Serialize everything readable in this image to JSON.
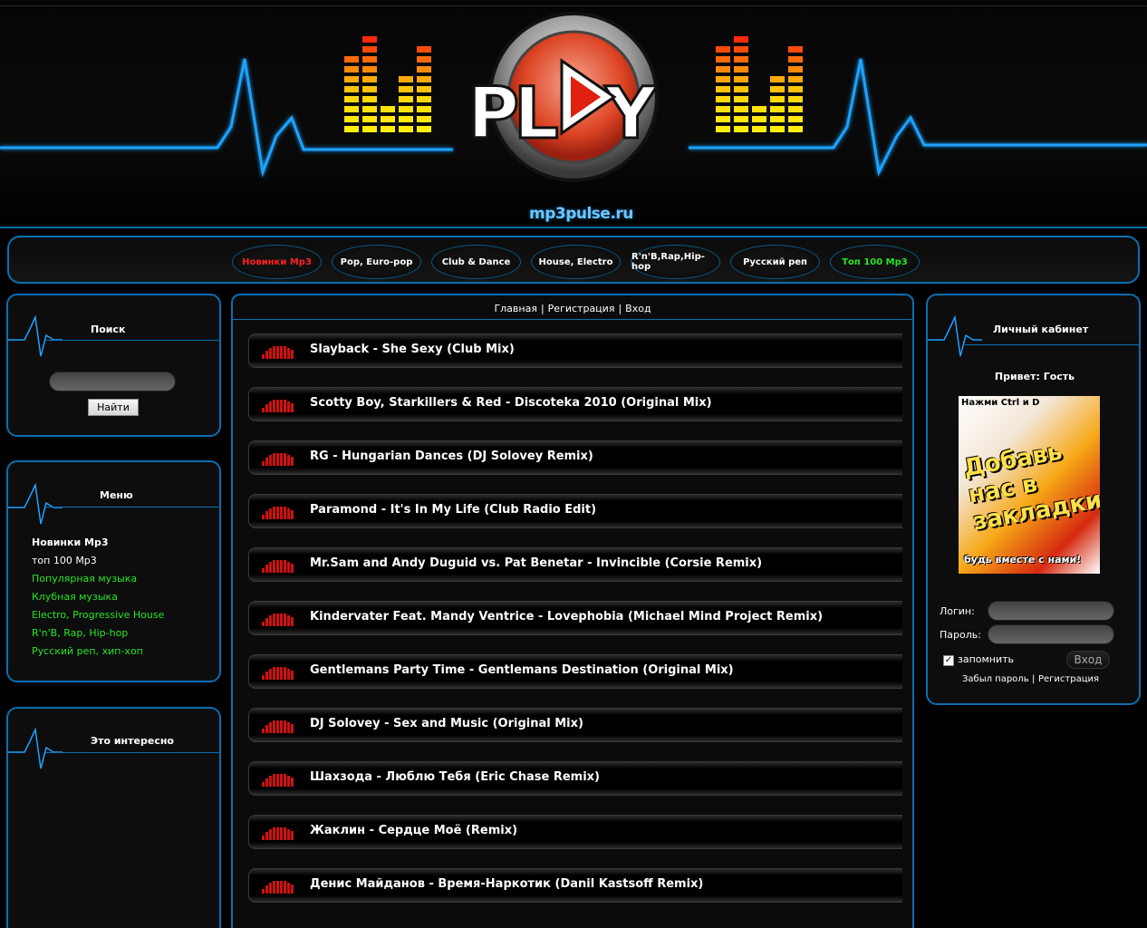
{
  "header": {
    "logo_text": "PLAY",
    "site_url": "mp3pulse.ru"
  },
  "nav": {
    "items": [
      {
        "label": "Новинки Mp3",
        "color": "#ff2020"
      },
      {
        "label": "Pop, Euro-pop"
      },
      {
        "label": "Club & Dance"
      },
      {
        "label": "House, Electro"
      },
      {
        "label": "R'n'B,Rap,Hip-hop"
      },
      {
        "label": "Русский реп"
      },
      {
        "label": "Топ 100 Mp3",
        "color": "#25e525"
      }
    ]
  },
  "search": {
    "title": "Поиск",
    "button_label": "Найти"
  },
  "menu": {
    "title": "Меню",
    "items": [
      {
        "label": "Новинки Mp3"
      },
      {
        "label": "топ 100 Mp3"
      },
      {
        "label": "Популярная музыка"
      },
      {
        "label": "Клубная музыка"
      },
      {
        "label": "Electro, Progressive House"
      },
      {
        "label": "R'n'B, Rap, Hip-hop"
      },
      {
        "label": "Русский реп, хип-хоп"
      }
    ]
  },
  "interesting": {
    "title": "Это интересно"
  },
  "breadcrumb": {
    "home": "Главная",
    "register": "Регистрация",
    "login": "Вход"
  },
  "tracks": [
    "Slayback - She Sexy (Club Mix)",
    "Scotty Boy, Starkillers & Red - Discoteka 2010 (Original Mix)",
    "RG - Hungarian Dances (DJ Solovey Remix)",
    "Paramond - It's In My Life (Club Radio Edit)",
    "Mr.Sam and Andy Duguid vs. Pat Benetar - Invincible (Corsie Remix)",
    "Kindervater Feat. Mandy Ventrice - Lovephobia (Michael Mind Project Remix)",
    "Gentlemans Party Time - Gentlemans Destination (Original Mix)",
    "DJ Solovey - Sex and Music (Original Mix)",
    "Шахзода - Люблю Тебя (Eric Chase Remix)",
    "Жаклин - Сердце Моё (Remix)",
    "Денис Майданов - Время-Наркотик (Danil Kastsoff Remix)"
  ],
  "account": {
    "title": "Личный кабинет",
    "greeting": "Привет: Гость",
    "banner_top": "Нажми Ctrl и D",
    "banner_main": "Добавь нас в закладки!",
    "banner_bottom": "будь вместе с нами!",
    "login_label": "Логин:",
    "password_label": "Пароль:",
    "remember_label": "запомнить",
    "login_button": "Вход",
    "forgot_link": "Забыл пароль",
    "register_link": "Регистрация"
  },
  "colors": {
    "accent_blue": "#0b6fb0",
    "link_green": "#25e525",
    "nav_red": "#ff2020"
  }
}
